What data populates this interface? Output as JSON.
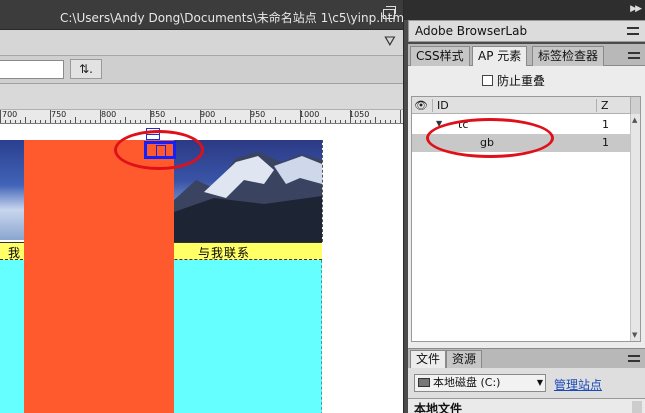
{
  "document": {
    "title_path": "C:\\Users\\Andy Dong\\Documents\\未命名站点 1\\c5\\yinp.html",
    "sync_button": "⇅.",
    "ruler_labels": [
      "700",
      "750",
      "800",
      "850",
      "900",
      "950",
      "1000",
      "1050"
    ]
  },
  "canvas": {
    "nav_text_left": "我",
    "nav_text_right": "与我联系",
    "ap_marker": "X"
  },
  "right_panel": {
    "browserlab_label": "Adobe BrowserLab",
    "tabs": [
      "CSS样式",
      "AP 元素",
      "标签检查器"
    ],
    "active_tab": "AP 元素",
    "prevent_overlap_label": "防止重叠",
    "columns": {
      "eye": "👁",
      "id": "ID",
      "z": "Z"
    },
    "rows": [
      {
        "id": "tc",
        "z": "1",
        "expanded": true,
        "selected": false
      },
      {
        "id": "gb",
        "z": "1",
        "selected": true
      }
    ],
    "files_tabs": [
      "文件",
      "资源"
    ],
    "disk_label": "本地磁盘 (C:)",
    "manage_sites": "管理站点",
    "local_files": "本地文件"
  },
  "colors": {
    "annotation_red": "#e0101a",
    "orange_div": "#ff5a2e",
    "cyan_div": "#66ffff",
    "yellow_nav": "#ffff66",
    "ap_selection_blue": "#1020ff"
  }
}
